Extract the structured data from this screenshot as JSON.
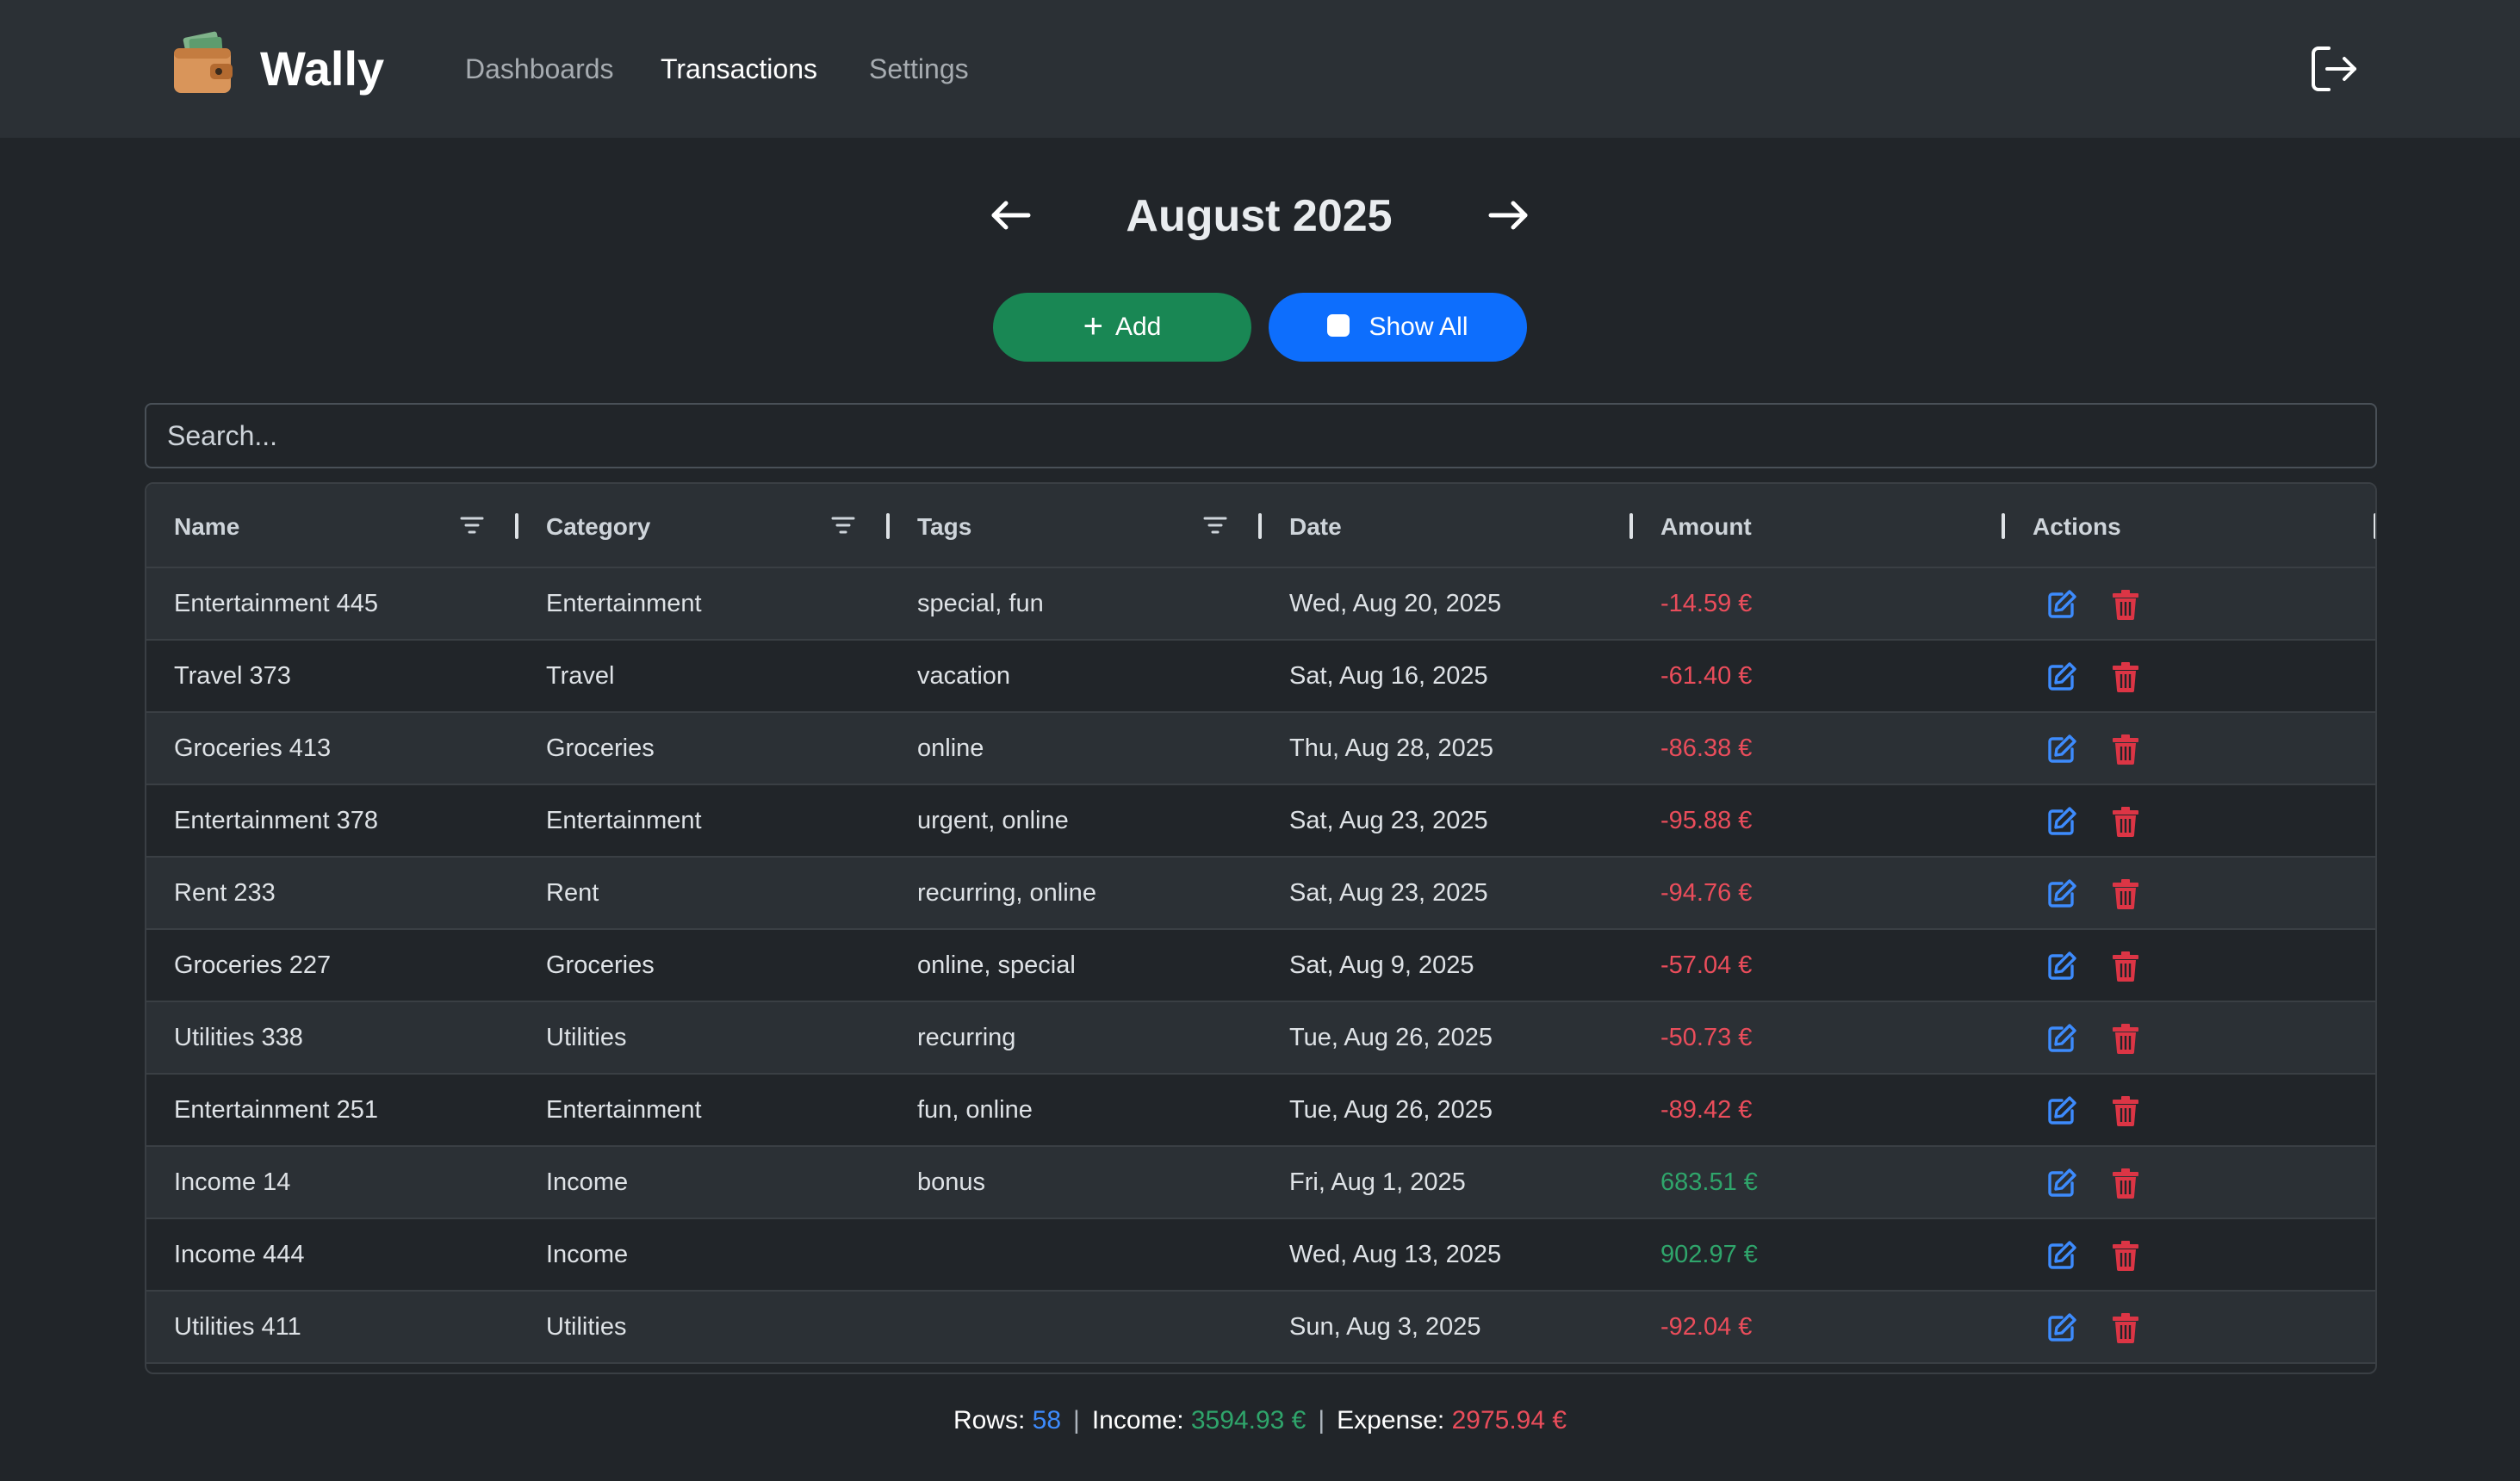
{
  "app": {
    "brand": "Wally"
  },
  "nav": {
    "dashboards": "Dashboards",
    "transactions": "Transactions",
    "settings": "Settings"
  },
  "month": {
    "title": "August 2025"
  },
  "buttons": {
    "add": "Add",
    "show_all": "Show All"
  },
  "search": {
    "placeholder": "Search..."
  },
  "table": {
    "headers": [
      "Name",
      "Category",
      "Tags",
      "Date",
      "Amount",
      "Actions"
    ],
    "rows": [
      {
        "name": "Entertainment 445",
        "category": "Entertainment",
        "tags": "special, fun",
        "date": "Wed, Aug 20, 2025",
        "amount": "-14.59 €"
      },
      {
        "name": "Travel 373",
        "category": "Travel",
        "tags": "vacation",
        "date": "Sat, Aug 16, 2025",
        "amount": "-61.40 €"
      },
      {
        "name": "Groceries 413",
        "category": "Groceries",
        "tags": "online",
        "date": "Thu, Aug 28, 2025",
        "amount": "-86.38 €"
      },
      {
        "name": "Entertainment 378",
        "category": "Entertainment",
        "tags": "urgent, online",
        "date": "Sat, Aug 23, 2025",
        "amount": "-95.88 €"
      },
      {
        "name": "Rent 233",
        "category": "Rent",
        "tags": "recurring, online",
        "date": "Sat, Aug 23, 2025",
        "amount": "-94.76 €"
      },
      {
        "name": "Groceries 227",
        "category": "Groceries",
        "tags": "online, special",
        "date": "Sat, Aug 9, 2025",
        "amount": "-57.04 €"
      },
      {
        "name": "Utilities 338",
        "category": "Utilities",
        "tags": "recurring",
        "date": "Tue, Aug 26, 2025",
        "amount": "-50.73 €"
      },
      {
        "name": "Entertainment 251",
        "category": "Entertainment",
        "tags": "fun, online",
        "date": "Tue, Aug 26, 2025",
        "amount": "-89.42 €"
      },
      {
        "name": "Income 14",
        "category": "Income",
        "tags": "bonus",
        "date": "Fri, Aug 1, 2025",
        "amount": "683.51 €"
      },
      {
        "name": "Income 444",
        "category": "Income",
        "tags": "",
        "date": "Wed, Aug 13, 2025",
        "amount": "902.97 €"
      },
      {
        "name": "Utilities 411",
        "category": "Utilities",
        "tags": "",
        "date": "Sun, Aug 3, 2025",
        "amount": "-92.04 €"
      }
    ]
  },
  "stats": {
    "rows_label": "Rows:",
    "rows_value": "58",
    "income_label": "Income:",
    "income_value": "3594.93 €",
    "expense_label": "Expense:",
    "expense_value": "2975.94 €",
    "separator": "|"
  },
  "colors": {
    "background": "#212529",
    "navbar": "#2b3035",
    "add_button": "#198754",
    "show_all_button": "#0d6efd",
    "expense": "#ea4d5b",
    "income": "#2fa56b",
    "rows_count": "#3d8bfd",
    "edit_icon": "#3d8bfd",
    "delete_icon": "#dc3545"
  },
  "icons": {
    "logo": "wallet-icon",
    "logout": "logout-icon",
    "prev": "arrow-left-icon",
    "next": "arrow-right-icon",
    "filter": "filter-icon",
    "edit": "edit-icon",
    "delete": "trash-icon"
  }
}
